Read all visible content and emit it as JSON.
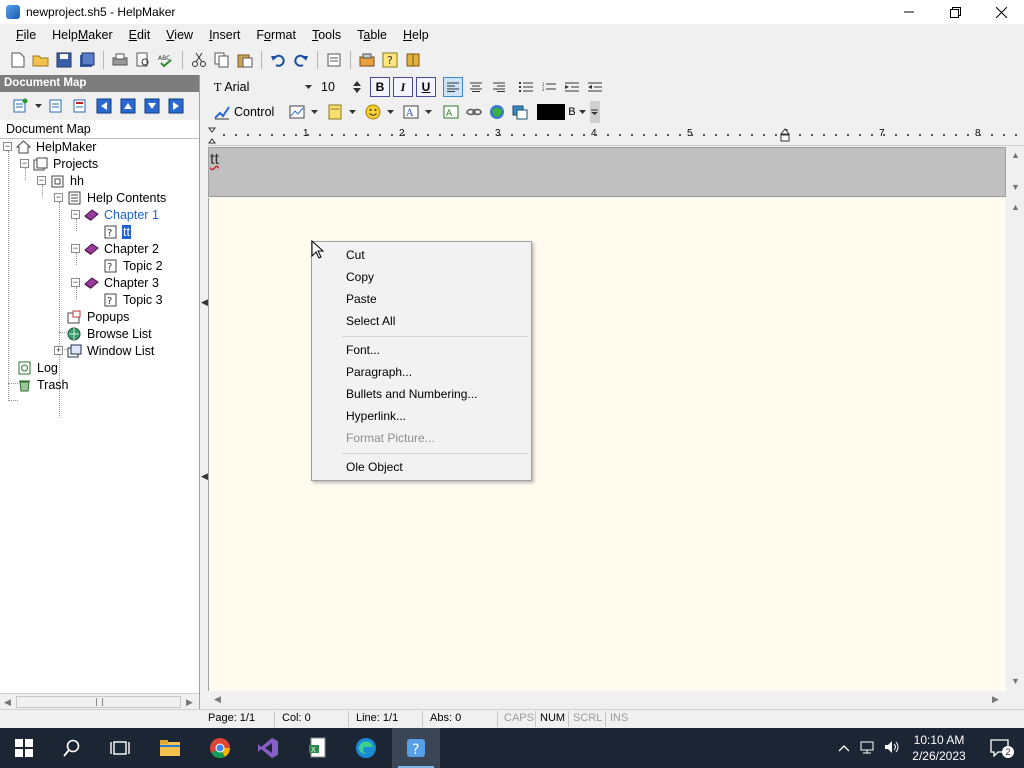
{
  "window": {
    "title": "newproject.sh5 - HelpMaker"
  },
  "menubar": {
    "items": [
      {
        "pre": "",
        "ul": "F",
        "post": "ile"
      },
      {
        "pre": "Help",
        "ul": "M",
        "post": "aker"
      },
      {
        "pre": "",
        "ul": "E",
        "post": "dit"
      },
      {
        "pre": "",
        "ul": "V",
        "post": "iew"
      },
      {
        "pre": "",
        "ul": "I",
        "post": "nsert"
      },
      {
        "pre": "F",
        "ul": "o",
        "post": "rmat"
      },
      {
        "pre": "",
        "ul": "T",
        "post": "ools"
      },
      {
        "pre": "T",
        "ul": "a",
        "post": "ble"
      },
      {
        "pre": "",
        "ul": "H",
        "post": "elp"
      }
    ]
  },
  "document_map": {
    "header": "Document Map",
    "tab_label": "Document Map",
    "tree": {
      "root": "HelpMaker",
      "projects": "Projects",
      "hh": "hh",
      "help_contents": "Help Contents",
      "chapter1": "Chapter 1",
      "topic_tt": "tt",
      "chapter2": "Chapter 2",
      "topic2": "Topic 2",
      "chapter3": "Chapter 3",
      "topic3": "Topic 3",
      "popups": "Popups",
      "browse_list": "Browse List",
      "window_list": "Window List",
      "log": "Log",
      "trash": "Trash"
    }
  },
  "format": {
    "font_name": "Arial",
    "font_size": "10",
    "bold": "B",
    "italic": "I",
    "underline": "U",
    "control_label": "Control",
    "color_label": "B"
  },
  "ruler": {
    "numbers": [
      "1",
      "2",
      "3",
      "4",
      "5",
      "6",
      "7",
      "8"
    ]
  },
  "editor": {
    "header_text": "tt"
  },
  "context_menu": {
    "cut": "Cut",
    "copy": "Copy",
    "paste": "Paste",
    "select_all": "Select All",
    "font": "Font...",
    "paragraph": "Paragraph...",
    "bullets": "Bullets and Numbering...",
    "hyperlink": "Hyperlink...",
    "format_picture": "Format Picture...",
    "ole_object": "Ole Object"
  },
  "statusbar": {
    "page": "Page: 1/1",
    "col": "Col: 0",
    "line": "Line: 1/1",
    "abs": "Abs: 0",
    "caps": "CAPS",
    "num": "NUM",
    "scrl": "SCRL",
    "ins": "INS"
  },
  "taskbar": {
    "time": "10:10 AM",
    "date": "2/26/2023",
    "notification_count": "2"
  }
}
